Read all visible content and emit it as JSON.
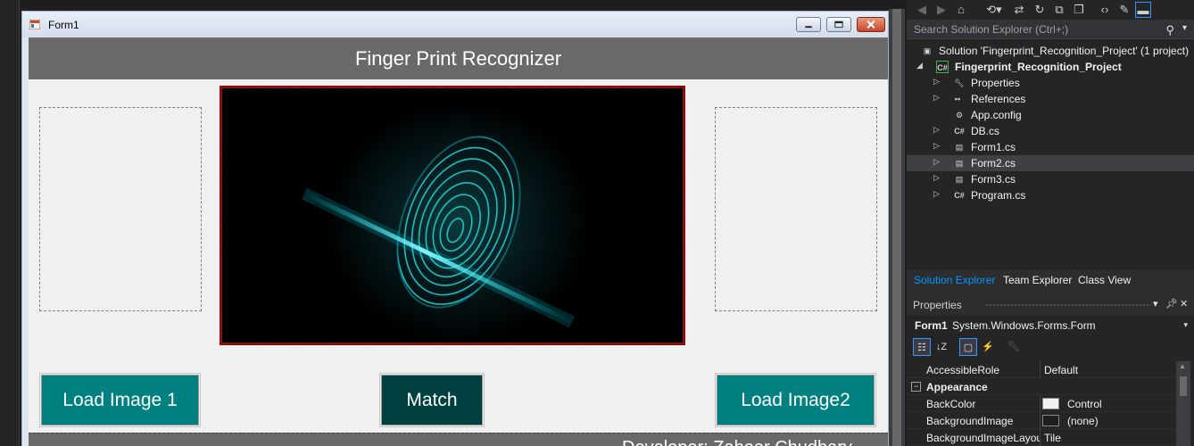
{
  "form": {
    "title": "Form1",
    "header": "Finger Print Recognizer",
    "buttons": {
      "load1": "Load Image 1",
      "match": "Match",
      "load2": "Load Image2"
    },
    "footer": "Developer: Zaheer Chudhary"
  },
  "solution_explorer": {
    "search_placeholder": "Search Solution Explorer (Ctrl+;)",
    "tree": [
      {
        "label": "Solution 'Fingerprint_Recognition_Project' (1 project)"
      },
      {
        "label": "Fingerprint_Recognition_Project"
      },
      {
        "label": "Properties"
      },
      {
        "label": "References"
      },
      {
        "label": "App.config"
      },
      {
        "label": "DB.cs"
      },
      {
        "label": "Form1.cs"
      },
      {
        "label": "Form2.cs"
      },
      {
        "label": "Form3.cs"
      },
      {
        "label": "Program.cs"
      }
    ],
    "tabs": [
      "Solution Explorer",
      "Team Explorer",
      "Class View"
    ],
    "active_tab": "Solution Explorer"
  },
  "properties": {
    "title": "Properties",
    "object_name": "Form1",
    "object_type": "System.Windows.Forms.Form",
    "rows": [
      {
        "name": "AccessibleRole",
        "value": "Default"
      },
      {
        "category": "Appearance"
      },
      {
        "name": "BackColor",
        "value": "Control",
        "swatch": "#f0f0f0"
      },
      {
        "name": "BackgroundImage",
        "value": "(none)",
        "swatch": "#1e1e1e"
      },
      {
        "name": "BackgroundImageLayout",
        "value": "Tile"
      }
    ]
  },
  "colors": {
    "teal": "#008080",
    "dark_teal": "#004040",
    "header_gray": "#696969",
    "selection": "#3f3f46",
    "accent_blue": "#0097fb"
  }
}
